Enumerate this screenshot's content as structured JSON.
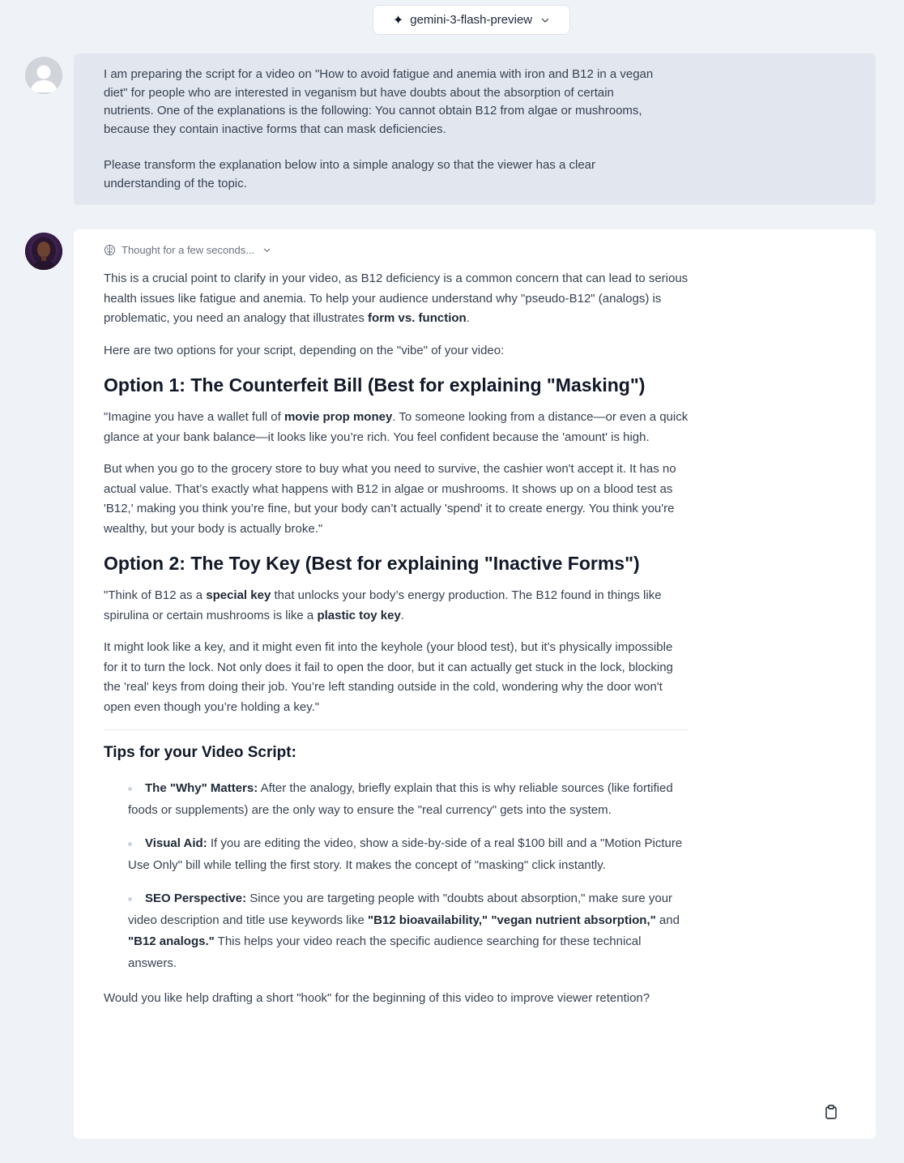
{
  "header": {
    "model_label": "gemini-3-flash-preview",
    "spark_glyph": "✦"
  },
  "user_message": {
    "paragraphs": [
      "I am preparing the script for a video on \"How to avoid fatigue and anemia with iron and B12 in a vegan diet\" for people who are interested in veganism but have doubts about the absorption of certain nutrients. One of the explanations is the following: You cannot obtain B12 from algae or mushrooms, because they contain inactive forms that can mask deficiencies.",
      "Please transform the explanation below into a simple analogy so that the viewer has a clear understanding of the topic."
    ]
  },
  "assistant": {
    "thought_label": "Thought for a few seconds...",
    "intro": {
      "a": "This is a crucial point to clarify in your video, as B12 deficiency is a common concern that can lead to serious health issues like fatigue and anemia. To help your audience understand why \"pseudo-B12\" (analogs) is problematic, you need an analogy that illustrates ",
      "bold": "form vs. function",
      "b": "."
    },
    "options_intro": "Here are two options for your script, depending on the \"vibe\" of your video:",
    "option1": {
      "heading": "Option 1: The Counterfeit Bill (Best for explaining \"Masking\")",
      "p1_a": "\"Imagine you have a wallet full of ",
      "p1_bold": "movie prop money",
      "p1_b": ". To someone looking from a distance—or even a quick glance at your bank balance—it looks like you’re rich. You feel confident because the 'amount' is high.",
      "p2": "But when you go to the grocery store to buy what you need to survive, the cashier won't accept it. It has no actual value. That’s exactly what happens with B12 in algae or mushrooms. It shows up on a blood test as 'B12,' making you think you’re fine, but your body can’t actually 'spend' it to create energy. You think you're wealthy, but your body is actually broke.\""
    },
    "option2": {
      "heading": "Option 2: The Toy Key (Best for explaining \"Inactive Forms\")",
      "p1_a": "\"Think of B12 as a ",
      "p1_bold1": "special key",
      "p1_b": " that unlocks your body’s energy production. The B12 found in things like spirulina or certain mushrooms is like a ",
      "p1_bold2": "plastic toy key",
      "p1_c": ".",
      "p2": "It might look like a key, and it might even fit into the keyhole (your blood test), but it’s physically impossible for it to turn the lock. Not only does it fail to open the door, but it can actually get stuck in the lock, blocking the 'real' keys from doing their job. You’re left standing outside in the cold, wondering why the door won't open even though you’re holding a key.\""
    },
    "tips": {
      "heading": "Tips for your Video Script:",
      "items": [
        {
          "bold": "The \"Why\" Matters:",
          "text": " After the analogy, briefly explain that this is why reliable sources (like fortified foods or supplements) are the only way to ensure the \"real currency\" gets into the system."
        },
        {
          "bold": "Visual Aid:",
          "text": " If you are editing the video, show a side-by-side of a real $100 bill and a \"Motion Picture Use Only\" bill while telling the first story. It makes the concept of \"masking\" click instantly."
        },
        {
          "bold": "SEO Perspective:",
          "text_a": " Since you are targeting people with \"doubts about absorption,\" make sure your video description and title use keywords like ",
          "bold2": "\"B12 bioavailability,\" \"vegan nutrient absorption,\"",
          "text_b": " and ",
          "bold3": "\"B12 analogs.\"",
          "text_c": " This helps your video reach the specific audience searching for these technical answers."
        }
      ]
    },
    "closing": "Would you like help drafting a short \"hook\" for the beginning of this video to improve viewer retention?"
  },
  "icons": {
    "model_spark": "sparkle-icon",
    "model_chevron": "chevron-down-icon",
    "thought_brain": "brain-icon",
    "thought_chevron": "chevron-down-icon",
    "copy": "clipboard-icon"
  }
}
